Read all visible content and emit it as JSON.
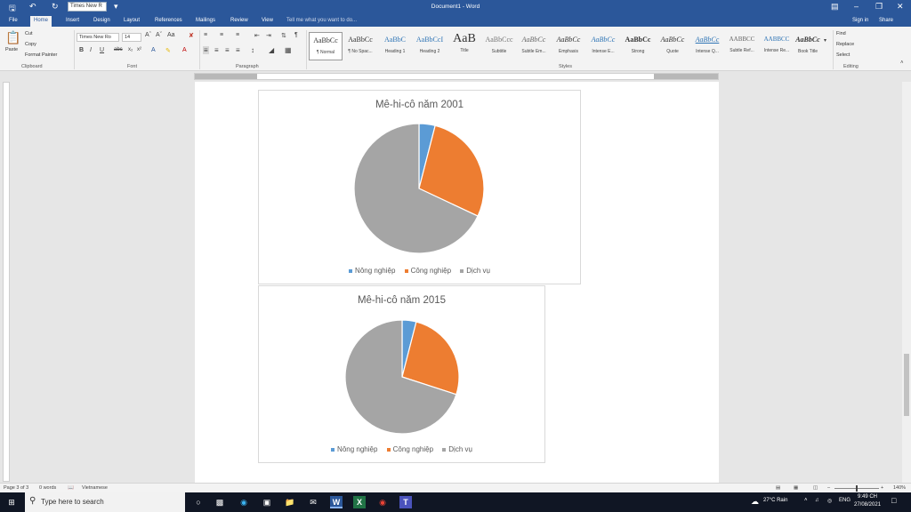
{
  "window": {
    "title": "Document1 - Word",
    "quick_font": "Times New R"
  },
  "tabs": [
    "File",
    "Home",
    "Insert",
    "Design",
    "Layout",
    "References",
    "Mailings",
    "Review",
    "View"
  ],
  "tell_me": "Tell me what you want to do...",
  "account": {
    "signin": "Sign in",
    "share": "Share"
  },
  "ribbon": {
    "clipboard": {
      "label": "Clipboard",
      "paste": "Paste",
      "cut": "Cut",
      "copy": "Copy",
      "format_painter": "Format Painter"
    },
    "font": {
      "label": "Font",
      "name": "Times New Ro",
      "size": "14"
    },
    "paragraph": {
      "label": "Paragraph"
    },
    "styles": {
      "label": "Styles",
      "items": [
        {
          "sample": "AaBbCc",
          "name": "¶ Normal"
        },
        {
          "sample": "AaBbCc",
          "name": "¶ No Spac..."
        },
        {
          "sample": "AaBbC",
          "name": "Heading 1"
        },
        {
          "sample": "AaBbCcI",
          "name": "Heading 2"
        },
        {
          "sample": "AaB",
          "name": "Title"
        },
        {
          "sample": "AaBbCcc",
          "name": "Subtitle"
        },
        {
          "sample": "AaBbCc",
          "name": "Subtle Em..."
        },
        {
          "sample": "AaBbCc",
          "name": "Emphasis"
        },
        {
          "sample": "AaBbCc",
          "name": "Intense E..."
        },
        {
          "sample": "AaBbCc",
          "name": "Strong"
        },
        {
          "sample": "AaBbCc",
          "name": "Quote"
        },
        {
          "sample": "AaBbCc",
          "name": "Intense Q..."
        },
        {
          "sample": "AABBCC",
          "name": "Subtle Ref..."
        },
        {
          "sample": "AABBCC",
          "name": "Intense Re..."
        },
        {
          "sample": "AaBbCc",
          "name": "Book Title"
        }
      ]
    },
    "editing": {
      "label": "Editing",
      "find": "Find",
      "replace": "Replace",
      "select": "Select"
    }
  },
  "status": {
    "page": "Page 3 of 3",
    "words": "0 words",
    "language": "Vietnamese",
    "zoom": "140%"
  },
  "taskbar": {
    "search_placeholder": "Type here to search",
    "weather": "27°C Rain",
    "lang": "ENG",
    "time": "9:49 CH",
    "date": "27/08/2021"
  },
  "colors": {
    "nong_nghiep": "#5b9bd5",
    "cong_nghiep": "#ed7d31",
    "dich_vu": "#a5a5a5",
    "ribbon_blue": "#2b579a"
  },
  "chart_data": [
    {
      "type": "pie",
      "title": "Mê-hi-cô năm 2001",
      "categories": [
        "Nông nghiệp",
        "Công nghiệp",
        "Dịch vụ"
      ],
      "values": [
        4,
        28,
        68
      ],
      "legend": "bottom"
    },
    {
      "type": "pie",
      "title": "Mê-hi-cô năm 2015",
      "categories": [
        "Nông nghiệp",
        "Công nghiệp",
        "Dịch vụ"
      ],
      "values": [
        4,
        26,
        70
      ],
      "legend": "bottom"
    }
  ]
}
